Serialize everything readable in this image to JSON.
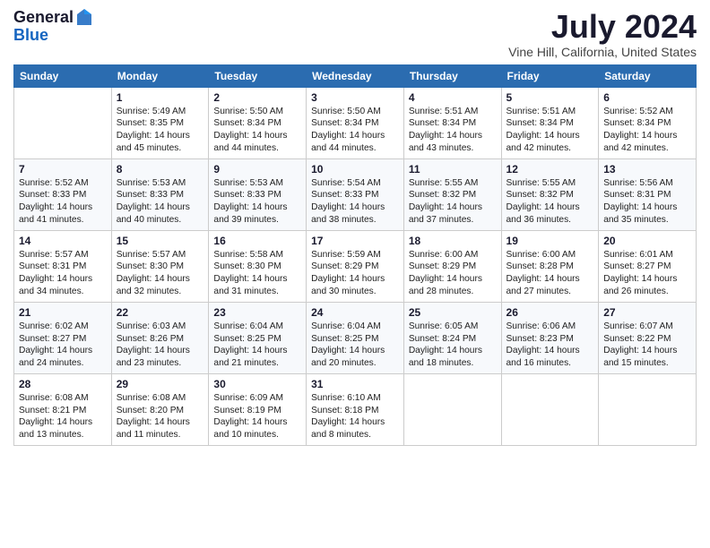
{
  "logo": {
    "general": "General",
    "blue": "Blue"
  },
  "title": "July 2024",
  "subtitle": "Vine Hill, California, United States",
  "days": [
    "Sunday",
    "Monday",
    "Tuesday",
    "Wednesday",
    "Thursday",
    "Friday",
    "Saturday"
  ],
  "weeks": [
    [
      {
        "num": "",
        "data": ""
      },
      {
        "num": "1",
        "data": "Sunrise: 5:49 AM\nSunset: 8:35 PM\nDaylight: 14 hours\nand 45 minutes."
      },
      {
        "num": "2",
        "data": "Sunrise: 5:50 AM\nSunset: 8:34 PM\nDaylight: 14 hours\nand 44 minutes."
      },
      {
        "num": "3",
        "data": "Sunrise: 5:50 AM\nSunset: 8:34 PM\nDaylight: 14 hours\nand 44 minutes."
      },
      {
        "num": "4",
        "data": "Sunrise: 5:51 AM\nSunset: 8:34 PM\nDaylight: 14 hours\nand 43 minutes."
      },
      {
        "num": "5",
        "data": "Sunrise: 5:51 AM\nSunset: 8:34 PM\nDaylight: 14 hours\nand 42 minutes."
      },
      {
        "num": "6",
        "data": "Sunrise: 5:52 AM\nSunset: 8:34 PM\nDaylight: 14 hours\nand 42 minutes."
      }
    ],
    [
      {
        "num": "7",
        "data": "Sunrise: 5:52 AM\nSunset: 8:33 PM\nDaylight: 14 hours\nand 41 minutes."
      },
      {
        "num": "8",
        "data": "Sunrise: 5:53 AM\nSunset: 8:33 PM\nDaylight: 14 hours\nand 40 minutes."
      },
      {
        "num": "9",
        "data": "Sunrise: 5:53 AM\nSunset: 8:33 PM\nDaylight: 14 hours\nand 39 minutes."
      },
      {
        "num": "10",
        "data": "Sunrise: 5:54 AM\nSunset: 8:33 PM\nDaylight: 14 hours\nand 38 minutes."
      },
      {
        "num": "11",
        "data": "Sunrise: 5:55 AM\nSunset: 8:32 PM\nDaylight: 14 hours\nand 37 minutes."
      },
      {
        "num": "12",
        "data": "Sunrise: 5:55 AM\nSunset: 8:32 PM\nDaylight: 14 hours\nand 36 minutes."
      },
      {
        "num": "13",
        "data": "Sunrise: 5:56 AM\nSunset: 8:31 PM\nDaylight: 14 hours\nand 35 minutes."
      }
    ],
    [
      {
        "num": "14",
        "data": "Sunrise: 5:57 AM\nSunset: 8:31 PM\nDaylight: 14 hours\nand 34 minutes."
      },
      {
        "num": "15",
        "data": "Sunrise: 5:57 AM\nSunset: 8:30 PM\nDaylight: 14 hours\nand 32 minutes."
      },
      {
        "num": "16",
        "data": "Sunrise: 5:58 AM\nSunset: 8:30 PM\nDaylight: 14 hours\nand 31 minutes."
      },
      {
        "num": "17",
        "data": "Sunrise: 5:59 AM\nSunset: 8:29 PM\nDaylight: 14 hours\nand 30 minutes."
      },
      {
        "num": "18",
        "data": "Sunrise: 6:00 AM\nSunset: 8:29 PM\nDaylight: 14 hours\nand 28 minutes."
      },
      {
        "num": "19",
        "data": "Sunrise: 6:00 AM\nSunset: 8:28 PM\nDaylight: 14 hours\nand 27 minutes."
      },
      {
        "num": "20",
        "data": "Sunrise: 6:01 AM\nSunset: 8:27 PM\nDaylight: 14 hours\nand 26 minutes."
      }
    ],
    [
      {
        "num": "21",
        "data": "Sunrise: 6:02 AM\nSunset: 8:27 PM\nDaylight: 14 hours\nand 24 minutes."
      },
      {
        "num": "22",
        "data": "Sunrise: 6:03 AM\nSunset: 8:26 PM\nDaylight: 14 hours\nand 23 minutes."
      },
      {
        "num": "23",
        "data": "Sunrise: 6:04 AM\nSunset: 8:25 PM\nDaylight: 14 hours\nand 21 minutes."
      },
      {
        "num": "24",
        "data": "Sunrise: 6:04 AM\nSunset: 8:25 PM\nDaylight: 14 hours\nand 20 minutes."
      },
      {
        "num": "25",
        "data": "Sunrise: 6:05 AM\nSunset: 8:24 PM\nDaylight: 14 hours\nand 18 minutes."
      },
      {
        "num": "26",
        "data": "Sunrise: 6:06 AM\nSunset: 8:23 PM\nDaylight: 14 hours\nand 16 minutes."
      },
      {
        "num": "27",
        "data": "Sunrise: 6:07 AM\nSunset: 8:22 PM\nDaylight: 14 hours\nand 15 minutes."
      }
    ],
    [
      {
        "num": "28",
        "data": "Sunrise: 6:08 AM\nSunset: 8:21 PM\nDaylight: 14 hours\nand 13 minutes."
      },
      {
        "num": "29",
        "data": "Sunrise: 6:08 AM\nSunset: 8:20 PM\nDaylight: 14 hours\nand 11 minutes."
      },
      {
        "num": "30",
        "data": "Sunrise: 6:09 AM\nSunset: 8:19 PM\nDaylight: 14 hours\nand 10 minutes."
      },
      {
        "num": "31",
        "data": "Sunrise: 6:10 AM\nSunset: 8:18 PM\nDaylight: 14 hours\nand 8 minutes."
      },
      {
        "num": "",
        "data": ""
      },
      {
        "num": "",
        "data": ""
      },
      {
        "num": "",
        "data": ""
      }
    ]
  ]
}
